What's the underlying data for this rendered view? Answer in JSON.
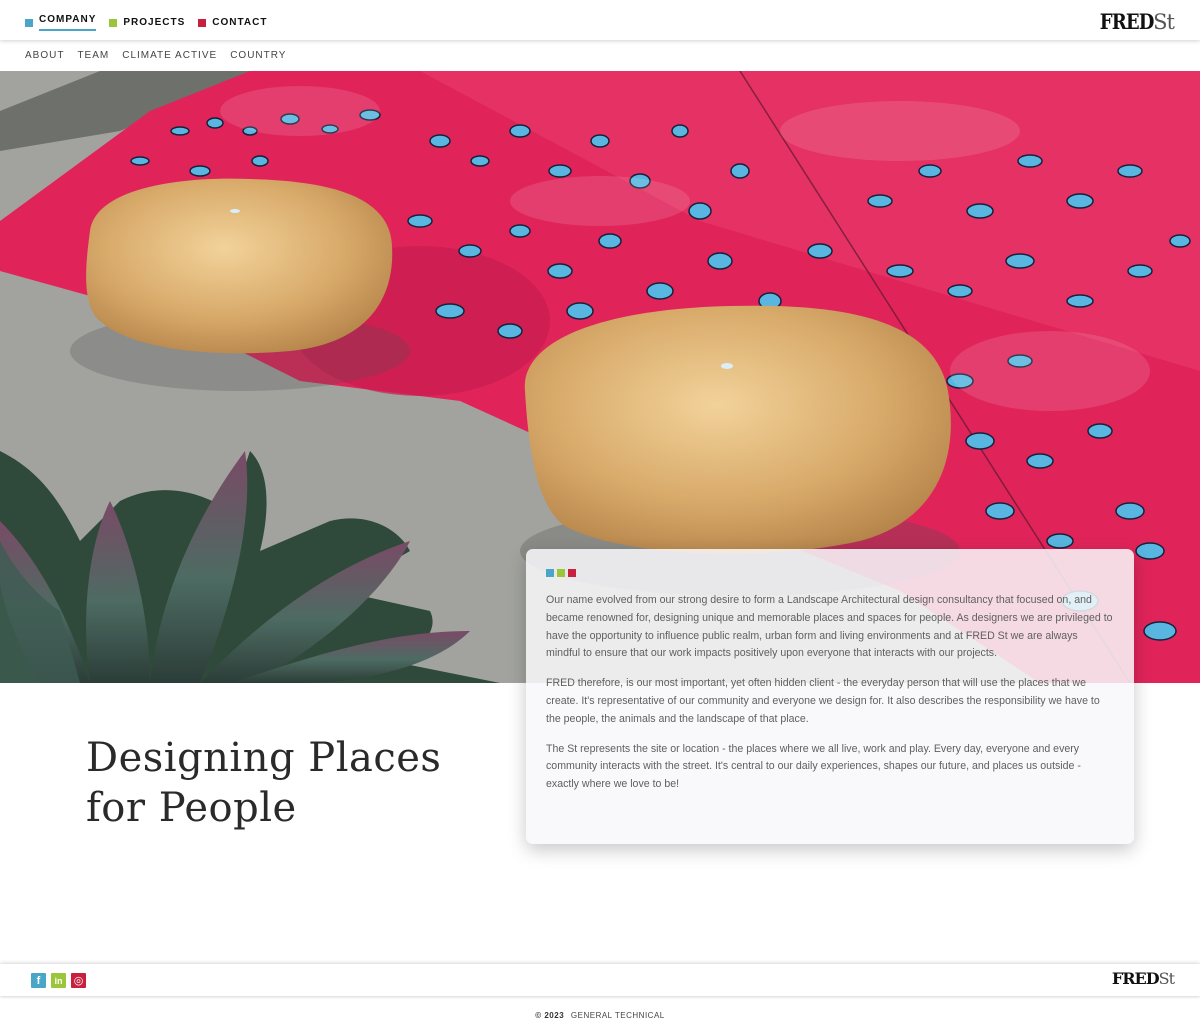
{
  "header": {
    "nav": [
      {
        "label": "COMPANY",
        "color": "#4aa6c6",
        "active": true
      },
      {
        "label": "PROJECTS",
        "color": "#9cc63a"
      },
      {
        "label": "CONTACT",
        "color": "#c8213f"
      }
    ],
    "logo": {
      "bold": "FRED",
      "light": "St"
    }
  },
  "subnav": [
    "ABOUT",
    "TEAM",
    "CLIMATE ACTIVE",
    "COUNTRY"
  ],
  "headline": "Designing Places for People",
  "card": {
    "dot_colors": [
      "#4aa6c6",
      "#9cc63a",
      "#c8213f"
    ],
    "paragraphs": [
      "Our name evolved from our strong desire to form a Landscape Architectural design consultancy that focused on, and became renowned for, designing unique and memorable places and spaces for people. As designers we are privileged to have the opportunity to influence public realm, urban form and living environments and at FRED St we are always mindful to ensure that our work impacts positively upon everyone that interacts with our projects.",
      "FRED therefore, is our most important, yet often hidden client - the everyday person that will use the places that we create. It's representative of our community and everyone we design for. It also describes the responsibility we have to the people, the animals and the landscape of that place.",
      "The St represents the site or location - the places where we all live, work and play. Every day, everyone and every community interacts with the street. It's central to our daily experiences, shapes our future, and places us outside - exactly where we love to be!"
    ]
  },
  "footer": {
    "social": [
      {
        "icon": "facebook-icon",
        "glyph": "f",
        "color": "#4aa6c6"
      },
      {
        "icon": "linkedin-icon",
        "glyph": "in",
        "color": "#9cc63a"
      },
      {
        "icon": "instagram-icon",
        "glyph": "◎",
        "color": "#c8213f"
      }
    ],
    "logo": {
      "bold": "FRED",
      "light": "St"
    },
    "year": "© 2023",
    "credit": "GENERAL TECHNICAL"
  }
}
